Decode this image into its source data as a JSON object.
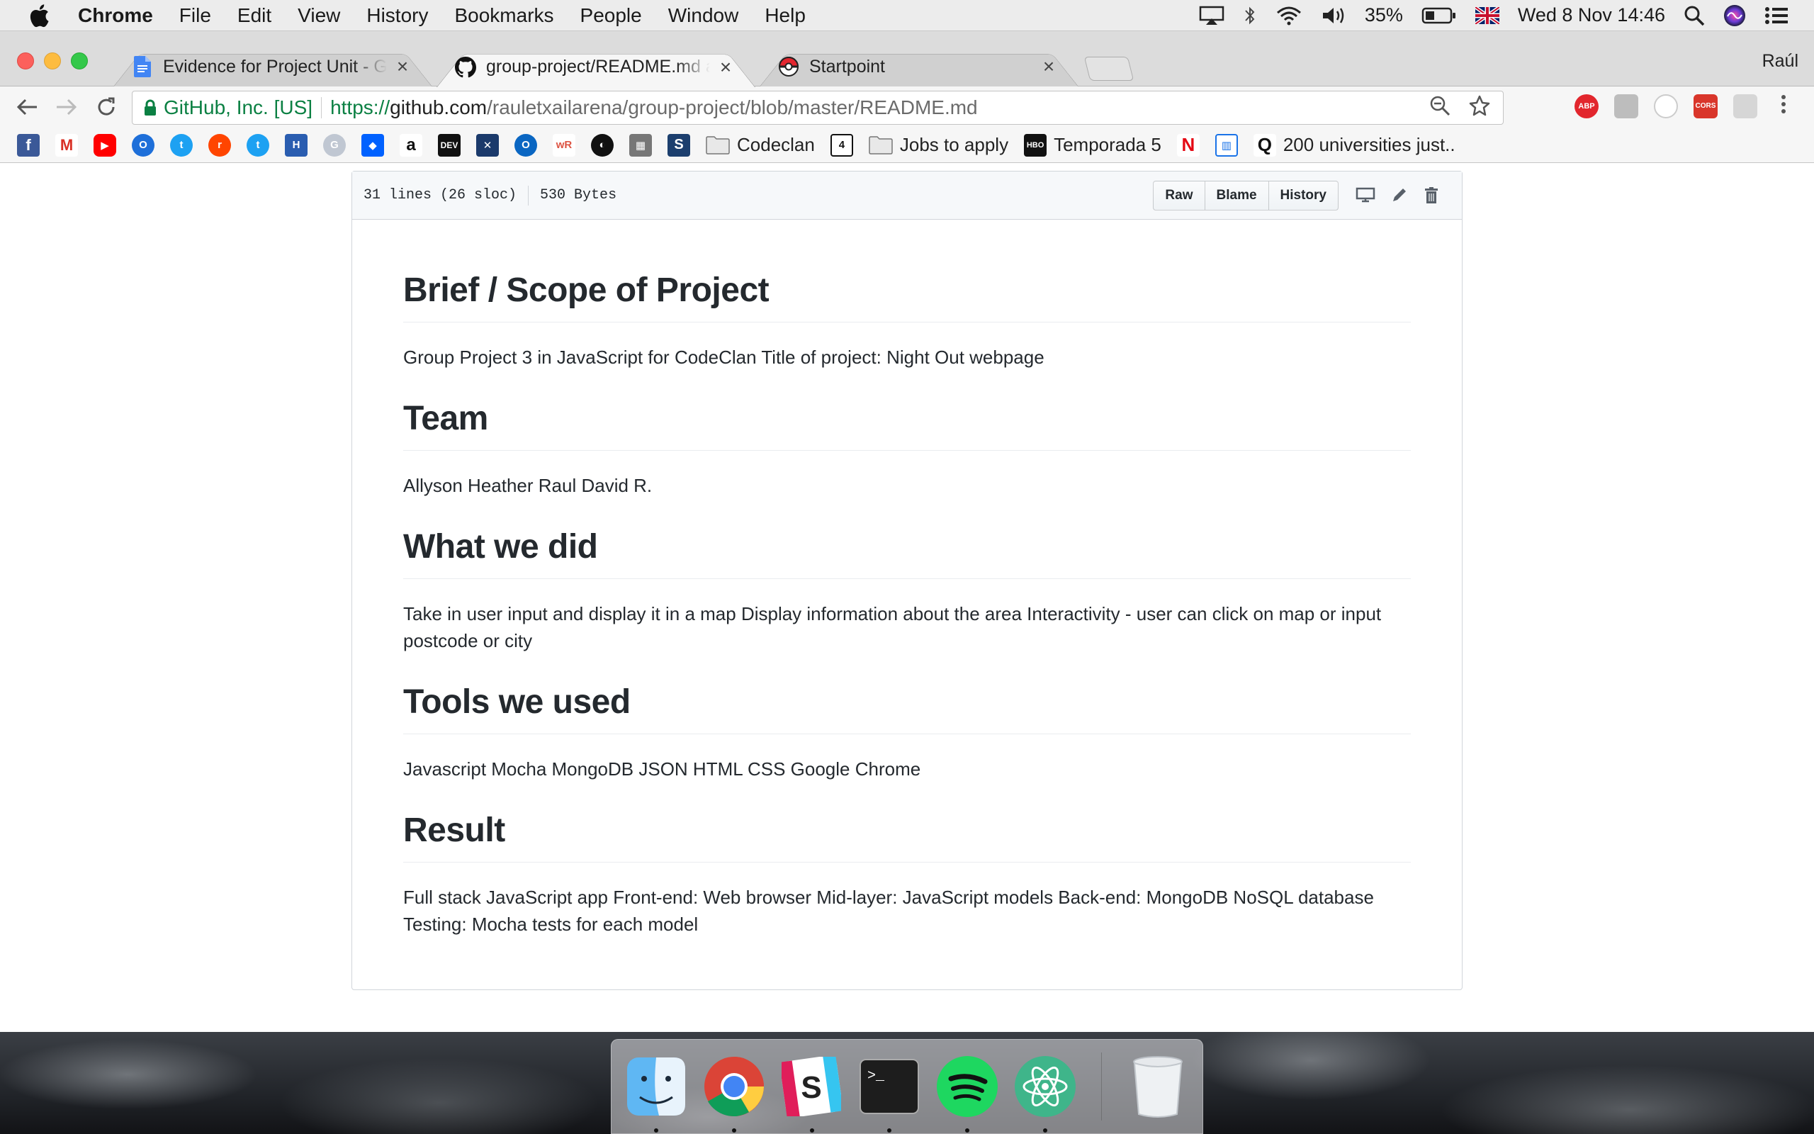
{
  "menubar": {
    "app_name": "Chrome",
    "menus": [
      "File",
      "Edit",
      "View",
      "History",
      "Bookmarks",
      "People",
      "Window",
      "Help"
    ],
    "battery": "35%",
    "datetime": "Wed 8 Nov  14:46"
  },
  "tabs": [
    {
      "title": "Evidence for Project Unit - Google Docs",
      "favicon": "google-docs-icon",
      "close": "×"
    },
    {
      "title": "group-project/README.md at master · rauletxailarena/group-project",
      "favicon": "github-icon",
      "close": "×"
    },
    {
      "title": "Startpoint",
      "favicon": "pokeball-icon",
      "close": "×"
    }
  ],
  "profile_name": "Raúl",
  "omnibox": {
    "ev_label": "GitHub, Inc. [US]",
    "url_scheme_host": "https://",
    "url_domain": "github.com",
    "url_path": "/rauletxailarena/group-project/blob/master/README.md"
  },
  "bookmarks": {
    "folders": [
      "Codeclan",
      "Jobs to apply",
      "Temporada 5",
      "200 universities just.."
    ]
  },
  "file_header": {
    "lines": "31 lines (26 sloc)",
    "size": "530 Bytes",
    "buttons": [
      "Raw",
      "Blame",
      "History"
    ]
  },
  "readme": {
    "sections": [
      {
        "heading": "Brief / Scope of Project",
        "body": "Group Project 3 in JavaScript for CodeClan Title of project: Night Out webpage"
      },
      {
        "heading": "Team",
        "body": "Allyson Heather Raul David R."
      },
      {
        "heading": "What we did",
        "body": "Take in user input and display it in a map Display information about the area Interactivity - user can click on map or input postcode or city"
      },
      {
        "heading": "Tools we used",
        "body": "Javascript Mocha MongoDB JSON HTML CSS Google Chrome"
      },
      {
        "heading": "Result",
        "body": "Full stack JavaScript app Front-end: Web browser Mid-layer: JavaScript models Back-end: MongoDB NoSQL database Testing: Mocha tests for each model"
      }
    ]
  },
  "dock": {
    "apps": [
      "finder-icon",
      "chrome-icon",
      "slack-icon",
      "terminal-icon",
      "spotify-icon",
      "atom-icon",
      "trash-icon"
    ]
  },
  "colors": {
    "github_green": "#0b8043",
    "text": "#24292e",
    "border": "#d1d5da"
  }
}
